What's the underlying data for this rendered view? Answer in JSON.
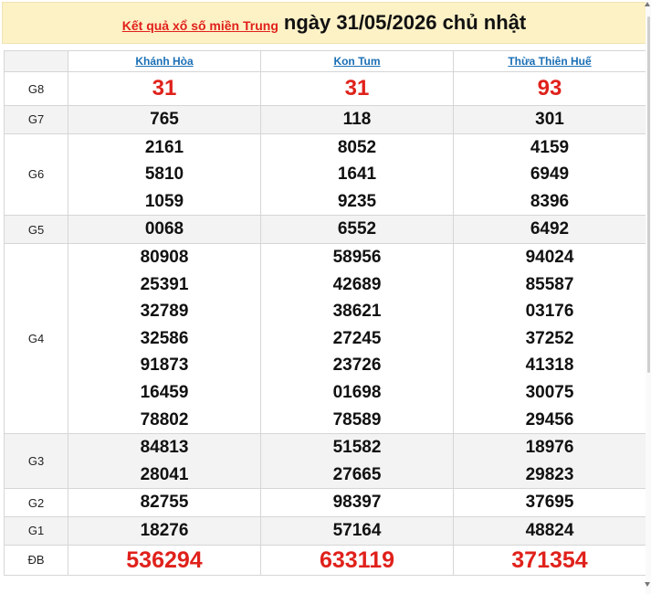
{
  "header": {
    "link_text": "Kết quả xổ số miền Trung",
    "date_text": "ngày 31/05/2026 chủ nhật"
  },
  "provinces": [
    "Khánh Hòa",
    "Kon Tum",
    "Thừa Thiên Huế"
  ],
  "prizes": [
    {
      "label": "G8",
      "values": [
        [
          "31"
        ],
        [
          "31"
        ],
        [
          "93"
        ]
      ]
    },
    {
      "label": "G7",
      "values": [
        [
          "765"
        ],
        [
          "118"
        ],
        [
          "301"
        ]
      ]
    },
    {
      "label": "G6",
      "values": [
        [
          "2161",
          "5810",
          "1059"
        ],
        [
          "8052",
          "1641",
          "9235"
        ],
        [
          "4159",
          "6949",
          "8396"
        ]
      ]
    },
    {
      "label": "G5",
      "values": [
        [
          "0068"
        ],
        [
          "6552"
        ],
        [
          "6492"
        ]
      ]
    },
    {
      "label": "G4",
      "values": [
        [
          "80908",
          "25391",
          "32789",
          "32586",
          "91873",
          "16459",
          "78802"
        ],
        [
          "58956",
          "42689",
          "38621",
          "27245",
          "23726",
          "01698",
          "78589"
        ],
        [
          "94024",
          "85587",
          "03176",
          "37252",
          "41318",
          "30075",
          "29456"
        ]
      ]
    },
    {
      "label": "G3",
      "values": [
        [
          "84813",
          "28041"
        ],
        [
          "51582",
          "27665"
        ],
        [
          "18976",
          "29823"
        ]
      ]
    },
    {
      "label": "G2",
      "values": [
        [
          "82755"
        ],
        [
          "98397"
        ],
        [
          "37695"
        ]
      ]
    },
    {
      "label": "G1",
      "values": [
        [
          "18276"
        ],
        [
          "57164"
        ],
        [
          "48824"
        ]
      ]
    },
    {
      "label": "ĐB",
      "values": [
        [
          "536294"
        ],
        [
          "633119"
        ],
        [
          "371354"
        ]
      ]
    }
  ]
}
